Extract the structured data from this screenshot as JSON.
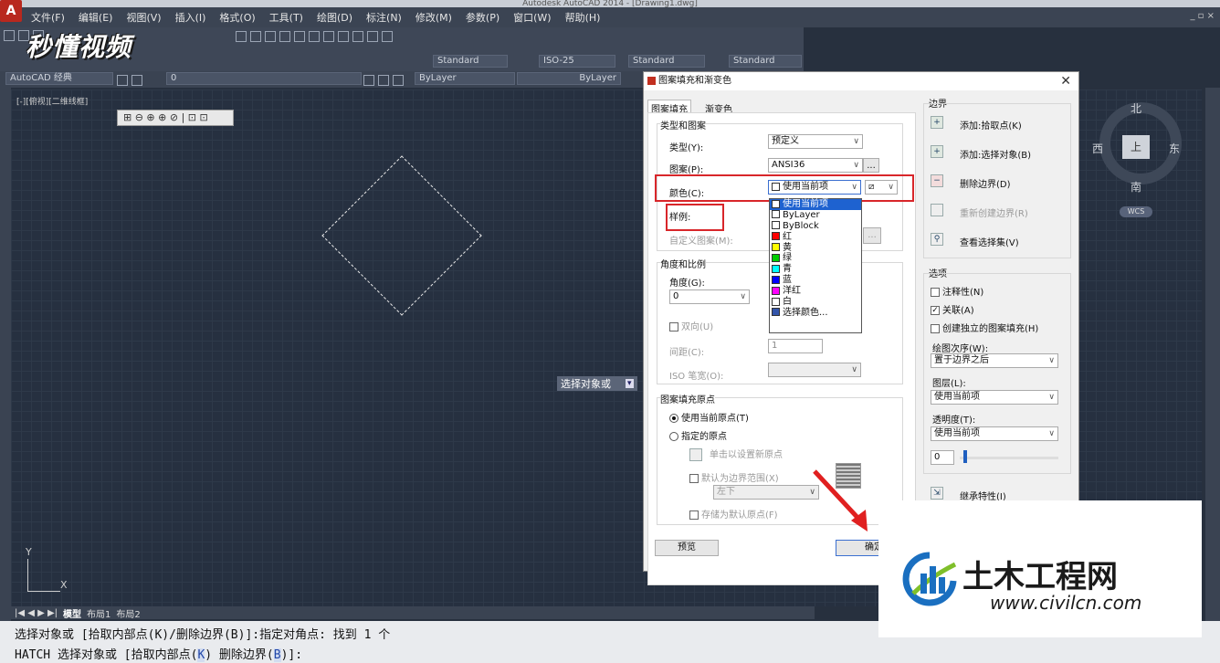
{
  "window_title": "Autodesk AutoCAD 2014 - [Drawing1.dwg]",
  "menu": [
    "文件(F)",
    "编辑(E)",
    "视图(V)",
    "插入(I)",
    "格式(O)",
    "工具(T)",
    "绘图(D)",
    "标注(N)",
    "修改(M)",
    "参数(P)",
    "窗口(W)",
    "帮助(H)"
  ],
  "watermark_logo": "秒懂视频",
  "toolbar": {
    "workspace": "AutoCAD 经典",
    "layer": "0",
    "bylayer1": "ByLayer",
    "bylayer2": "ByLayer",
    "text_style": "Standard",
    "dim_style": "ISO-25",
    "table_style": "Standard",
    "ml_style": "Standard"
  },
  "viewport_label": "[-][俯视][二维线框]",
  "compass": {
    "north": "北",
    "south": "南",
    "east": "东",
    "west": "西",
    "center": "上",
    "wcs": "WCS"
  },
  "select_prompt": "选择对象或",
  "ucs": {
    "y": "Y",
    "x": "X"
  },
  "layout_tabs": [
    "模型",
    "布局1",
    "布局2"
  ],
  "command": {
    "line1": "选择对象或 [拾取内部点(K)/删除边界(B)]:指定对角点: 找到 1 个",
    "line2_prefix": "HATCH 选择对象或 [拾取内部点(",
    "k": "K",
    "mid": ") 删除边界(",
    "b": "B",
    "line2_suffix": ")]:"
  },
  "dialog": {
    "title": "图案填充和渐变色",
    "tab_hatch": "图案填充",
    "tab_gradient": "渐变色",
    "type_pattern_group": "类型和图案",
    "type_label": "类型(Y):",
    "type_value": "预定义",
    "pattern_label": "图案(P):",
    "pattern_value": "ANSI36",
    "color_label": "颜色(C):",
    "color_value": "使用当前项",
    "swatch_label": "样例:",
    "custom_label": "自定义图案(M):",
    "color_options": [
      "使用当前项",
      "ByLayer",
      "ByBlock",
      "红",
      "黄",
      "绿",
      "青",
      "蓝",
      "洋红",
      "白",
      "选择颜色..."
    ],
    "color_swatches": [
      "#ffffff",
      "#ffffff",
      "#ffffff",
      "#ff0000",
      "#ffff00",
      "#00cc00",
      "#00ffff",
      "#0000ff",
      "#ff00ff",
      "#ffffff",
      "#3355aa"
    ],
    "angle_group": "角度和比例",
    "angle_label": "角度(G):",
    "angle_value": "0",
    "double_label": "双向(U)",
    "spacing_label": "间距(C):",
    "spacing_value": "1",
    "iso_label": "ISO 笔宽(O):",
    "origin_group": "图案填充原点",
    "use_current_origin": "使用当前原点(T)",
    "specified_origin": "指定的原点",
    "click_set_origin": "单击以设置新原点",
    "default_boundary": "默认为边界范围(X)",
    "corner_value": "左下",
    "store_default": "存储为默认原点(F)",
    "preview_btn": "预览",
    "ok_btn": "确定",
    "boundary_group": "边界",
    "add_pick": "添加:拾取点(K)",
    "add_select": "添加:选择对象(B)",
    "remove_boundary": "删除边界(D)",
    "recreate_boundary": "重新创建边界(R)",
    "view_selection": "查看选择集(V)",
    "options_group": "选项",
    "annotative": "注释性(N)",
    "associative": "关联(A)",
    "separate": "创建独立的图案填充(H)",
    "draw_order_label": "绘图次序(W):",
    "draw_order_value": "置于边界之后",
    "layer_label": "图层(L):",
    "layer_value": "使用当前项",
    "transparency_label": "透明度(T):",
    "transparency_value": "使用当前项",
    "transparency_num": "0",
    "inherit": "继承特性(I)"
  },
  "watermark": {
    "site": "土木工程网",
    "url": "www.civilcn.com"
  },
  "colors": {
    "accent_red": "#d8262a",
    "canvas": "#263040",
    "watermark_blue": "#1a6fc0",
    "watermark_green": "#7fbf2a"
  }
}
